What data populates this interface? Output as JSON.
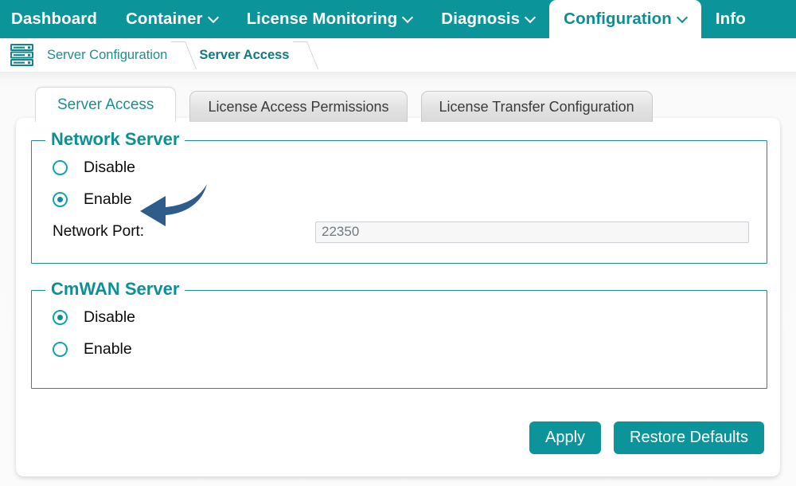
{
  "nav": {
    "items": [
      {
        "label": "Dashboard",
        "has_caret": false,
        "active": false
      },
      {
        "label": "Container",
        "has_caret": true,
        "active": false
      },
      {
        "label": "License Monitoring",
        "has_caret": true,
        "active": false
      },
      {
        "label": "Diagnosis",
        "has_caret": true,
        "active": false
      },
      {
        "label": "Configuration",
        "has_caret": true,
        "active": true
      },
      {
        "label": "Info",
        "has_caret": false,
        "active": false
      }
    ]
  },
  "breadcrumb": {
    "icon": "server-rack-icon",
    "items": [
      {
        "label": "Server Configuration",
        "current": false
      },
      {
        "label": "Server Access",
        "current": true
      }
    ]
  },
  "tabs": [
    {
      "label": "Server Access",
      "active": true
    },
    {
      "label": "License Access Permissions",
      "active": false
    },
    {
      "label": "License Transfer Configuration",
      "active": false
    }
  ],
  "network_server": {
    "legend": "Network Server",
    "options": [
      {
        "label": "Disable",
        "selected": false
      },
      {
        "label": "Enable",
        "selected": true
      }
    ],
    "port": {
      "label": "Network Port:",
      "value": "22350",
      "placeholder": ""
    }
  },
  "cmwan_server": {
    "legend": "CmWAN Server",
    "options": [
      {
        "label": "Disable",
        "selected": true
      },
      {
        "label": "Enable",
        "selected": false
      }
    ]
  },
  "actions": {
    "apply_label": "Apply",
    "restore_label": "Restore Defaults"
  },
  "annotation": {
    "arrow": "curved-left-arrow",
    "points_at": "Enable",
    "color": "#2e5d8c"
  },
  "colors": {
    "brand_teal": "#0b9499",
    "legend_teal": "#0c9095",
    "radio_teal": "#15a3ab",
    "breadcrumb_teal": "#1a8f93",
    "arrow_blue": "#2e5d8c",
    "page_bg": "#fbfbfb"
  }
}
